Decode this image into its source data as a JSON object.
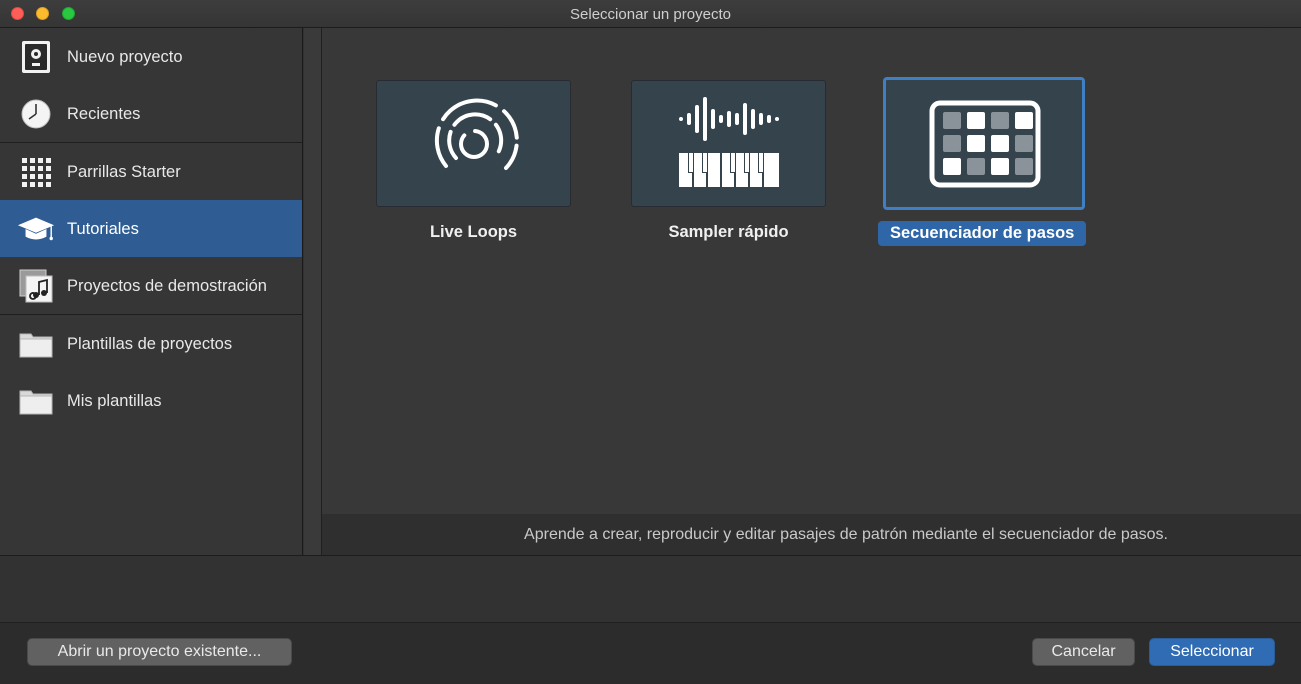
{
  "window": {
    "title": "Seleccionar un proyecto"
  },
  "sidebar": {
    "items": [
      {
        "label": "Nuevo proyecto",
        "icon": "new-project-icon"
      },
      {
        "label": "Recientes",
        "icon": "clock-icon"
      },
      {
        "label": "Parrillas Starter",
        "icon": "grid-icon"
      },
      {
        "label": "Tutoriales",
        "icon": "graduation-cap-icon",
        "selected": true
      },
      {
        "label": "Proyectos de demostración",
        "icon": "music-note-icon"
      },
      {
        "label": "Plantillas de proyectos",
        "icon": "folder-icon"
      },
      {
        "label": "Mis plantillas",
        "icon": "folder-icon"
      }
    ]
  },
  "tiles": [
    {
      "label": "Live Loops",
      "icon": "live-loops-icon"
    },
    {
      "label": "Sampler rápido",
      "icon": "sampler-icon"
    },
    {
      "label": "Secuenciador de pasos",
      "icon": "step-sequencer-icon",
      "selected": true
    }
  ],
  "description": "Aprende a crear, reproducir y editar pasajes de patrón mediante el secuenciador de pasos.",
  "footer": {
    "open_existing": "Abrir un proyecto existente...",
    "cancel": "Cancelar",
    "select": "Seleccionar"
  },
  "colors": {
    "accent": "#2f6cb3",
    "selection": "#2f5d93",
    "tile_bg": "#35434d"
  }
}
